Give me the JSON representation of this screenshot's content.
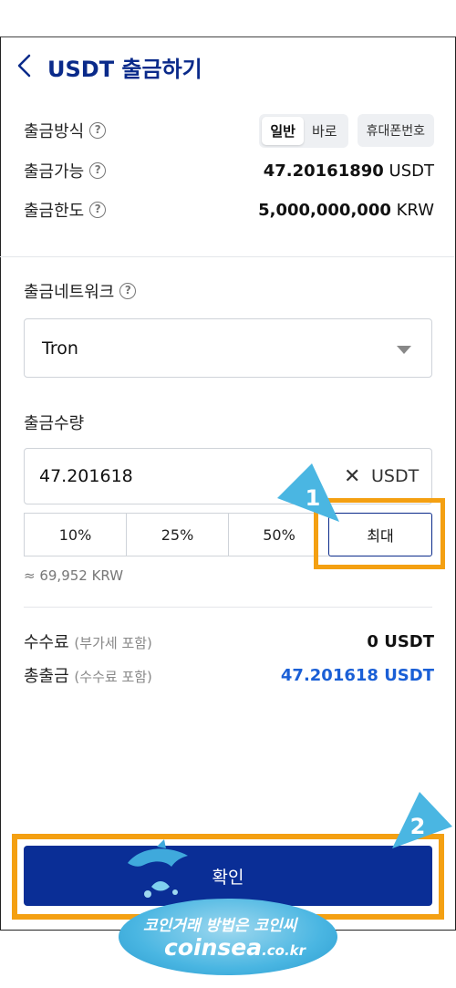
{
  "header": {
    "title": "USDT 출금하기"
  },
  "info": {
    "method_label": "출금방식",
    "method_options": [
      "일반",
      "바로"
    ],
    "phone_option": "휴대폰번호",
    "available_label": "출금가능",
    "available_amount": "47.20161890",
    "available_unit": "USDT",
    "limit_label": "출금한도",
    "limit_amount": "5,000,000,000",
    "limit_unit": "KRW"
  },
  "network": {
    "label": "출금네트워크",
    "selected": "Tron"
  },
  "amount": {
    "label": "출금수량",
    "value": "47.201618",
    "unit": "USDT",
    "percent_buttons": [
      "10%",
      "25%",
      "50%",
      "최대"
    ],
    "krw_estimate": "≈ 69,952 KRW"
  },
  "fees": {
    "fee_label": "수수료",
    "fee_note": "(부가세 포함)",
    "fee_value": "0 USDT",
    "total_label": "총출금",
    "total_note": "(수수료 포함)",
    "total_value": "47.201618 USDT"
  },
  "confirm_label": "확인",
  "annotations": {
    "marker1": "1",
    "marker2": "2",
    "highlight_color": "#f4a012",
    "marker_color": "#4ab6e2"
  },
  "watermark": {
    "line1": "코인거래 방법은 코인씨",
    "domain": "coinsea",
    "tld": ".co.kr"
  },
  "colors": {
    "brand": "#0a2e96",
    "accent_blue": "#1a5fd6"
  }
}
